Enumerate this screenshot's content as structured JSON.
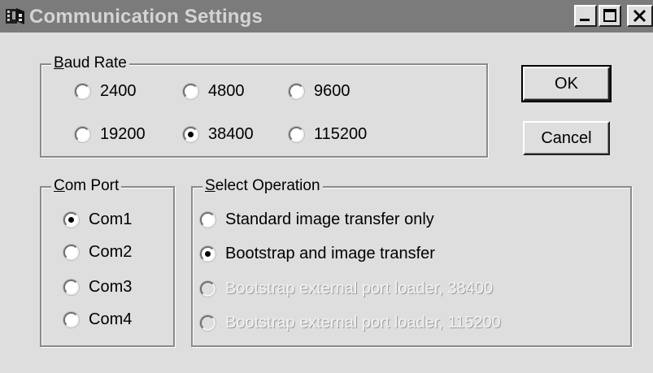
{
  "window": {
    "title": "Communication Settings",
    "controls": {
      "minimize": "_",
      "maximize": "□",
      "close": "×"
    },
    "icon": "app-icon"
  },
  "baud_rate": {
    "label_mnemonic": "B",
    "label_rest": "aud Rate",
    "options": [
      "2400",
      "4800",
      "9600",
      "19200",
      "38400",
      "115200"
    ],
    "selected": "38400"
  },
  "com_port": {
    "label_mnemonic": "C",
    "label_rest": "om Port",
    "options": [
      "Com1",
      "Com2",
      "Com3",
      "Com4"
    ],
    "selected": "Com1"
  },
  "select_operation": {
    "label_mnemonic": "S",
    "label_rest": "elect Operation",
    "options": [
      "Standard image transfer only",
      "Bootstrap and image transfer",
      "Bootstrap external port loader, 38400",
      "Bootstrap external port loader, 115200"
    ],
    "selected": "Bootstrap and image transfer",
    "disabled": [
      "Bootstrap external port loader, 38400",
      "Bootstrap external port loader, 115200"
    ]
  },
  "buttons": {
    "ok": "OK",
    "cancel": "Cancel"
  }
}
